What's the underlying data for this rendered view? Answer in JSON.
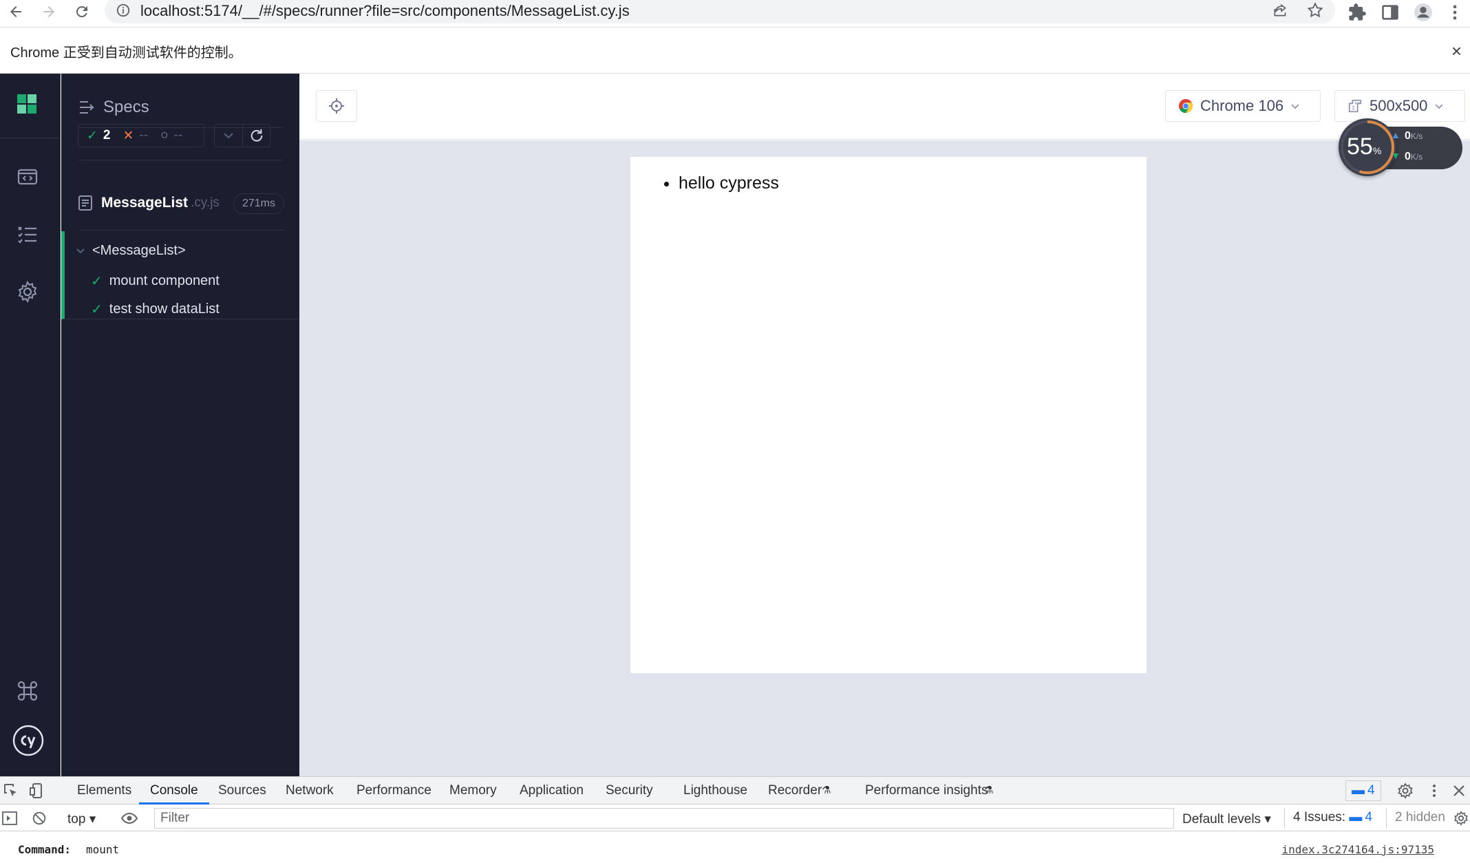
{
  "browser": {
    "url": "localhost:5174/__/#/specs/runner?file=src/components/MessageList.cy.js",
    "infobar_message": "Chrome 正受到自动测试软件的控制。",
    "infobar_close": "×"
  },
  "sidebar": {
    "items": [
      "runner-icon",
      "specs-list-icon",
      "settings-icon"
    ],
    "bottom": [
      "keyboard-shortcuts-icon",
      "cypress-logo-icon"
    ]
  },
  "reporter": {
    "header_label": "Specs",
    "stats": {
      "passed": "2",
      "failed": "--",
      "pending": "--"
    },
    "spec": {
      "name": "MessageList",
      "ext": ".cy.js",
      "duration": "271ms"
    },
    "suite": {
      "title": "<MessageList>",
      "tests": [
        {
          "label": "mount component",
          "state": "passed"
        },
        {
          "label": "test show dataList",
          "state": "passed"
        }
      ]
    }
  },
  "toolbar": {
    "browser_label": "Chrome 106",
    "viewport_label": "500x500"
  },
  "aut": {
    "list_items": [
      "hello cypress"
    ]
  },
  "net_monitor": {
    "percent": "55",
    "percent_unit": "%",
    "upload": "0",
    "download": "0",
    "unit": "K/s"
  },
  "devtools": {
    "tabs": [
      "Elements",
      "Console",
      "Sources",
      "Network",
      "Performance",
      "Memory",
      "Application",
      "Security",
      "Lighthouse",
      "Recorder",
      "Performance insights"
    ],
    "active_tab": "Console",
    "messages_count": "4",
    "context": "top",
    "filter_placeholder": "Filter",
    "levels": "Default levels ▾",
    "issues_label": "4 Issues:",
    "issues_count": "4",
    "hidden": "2 hidden",
    "log": {
      "key": "Command:",
      "value": "mount",
      "source": "index.3c274164.js:97135"
    }
  },
  "colors": {
    "accent": "#1fa971",
    "sidebar_bg": "#1b1e2e",
    "stage_bg": "#e1e3ed",
    "link": "#1a73e8"
  }
}
